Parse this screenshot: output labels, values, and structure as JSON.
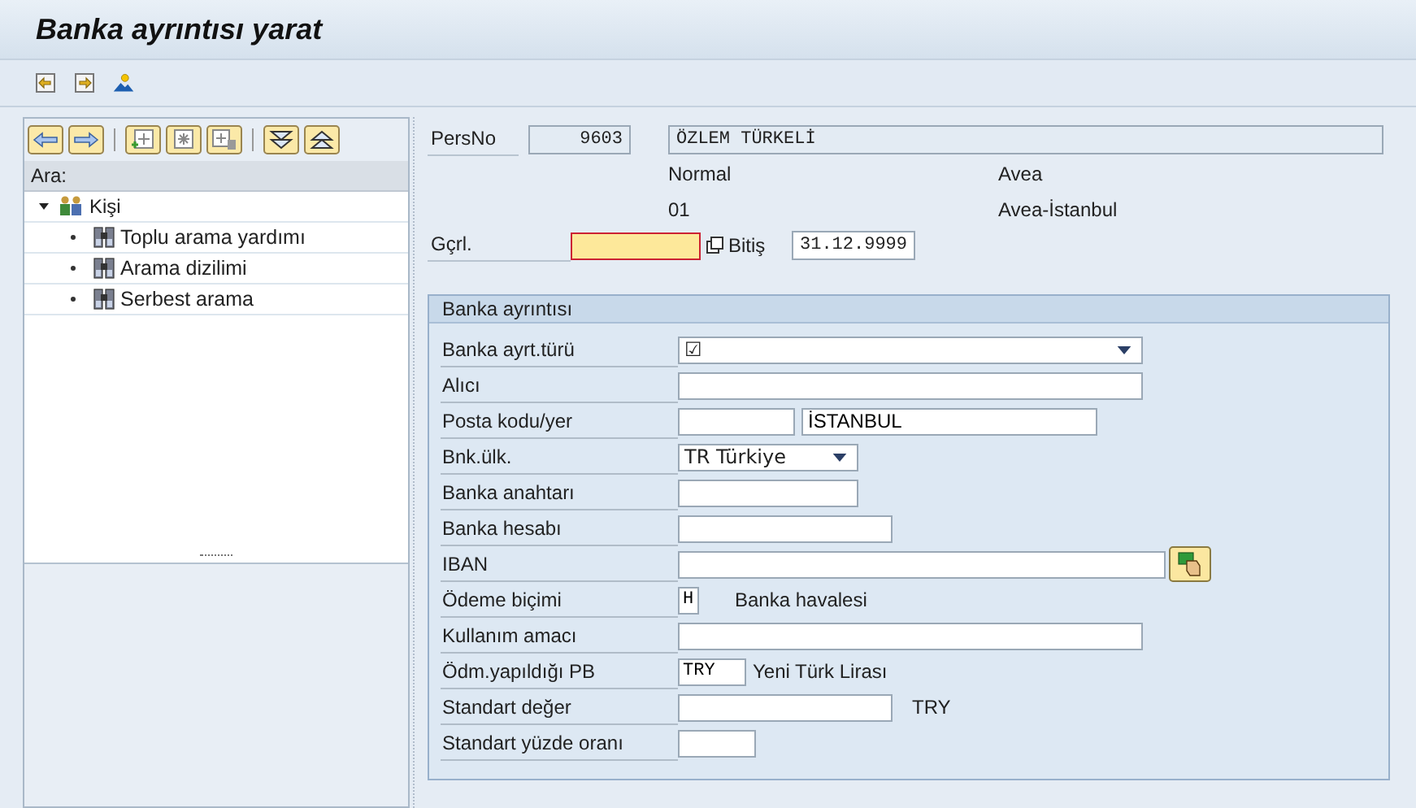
{
  "window": {
    "title": "Banka ayrıntısı yarat"
  },
  "toolbar": [
    {
      "kind": "prev"
    },
    {
      "kind": "next"
    },
    {
      "kind": "image"
    }
  ],
  "left_panel": {
    "toolbar": [
      {
        "kind": "back"
      },
      {
        "kind": "forward"
      },
      {
        "kind": "sep"
      },
      {
        "kind": "new"
      },
      {
        "kind": "star"
      },
      {
        "kind": "delete"
      },
      {
        "kind": "sep"
      },
      {
        "kind": "down"
      },
      {
        "kind": "up"
      }
    ],
    "heading": "Ara:",
    "tree": [
      {
        "label": "Kişi",
        "expanded": true,
        "children": [
          {
            "label": "Toplu arama yardımı"
          },
          {
            "label": "Arama dizilimi"
          },
          {
            "label": "Serbest arama"
          }
        ]
      }
    ]
  },
  "header": {
    "persno_label": "PersNo",
    "persno": "9603",
    "name": "ÖZLEM TÜRKELİ",
    "info": [
      [
        "Normal",
        "Avea"
      ],
      [
        "01",
        "Avea-İstanbul"
      ]
    ],
    "start_label": "Gçrl.",
    "end_label": "Bitiş",
    "end_value": "31.12.9999"
  },
  "bank_section": {
    "title": "Banka ayrıntısı",
    "rows": [
      {
        "label": "Banka ayrt.türü",
        "items": [
          {
            "kind": "dropdown",
            "value": "☑"
          }
        ]
      },
      {
        "label": "Alıcı",
        "items": [
          {
            "kind": "input",
            "value": ""
          }
        ]
      },
      {
        "label": "Posta kodu/yer",
        "items": [
          {
            "kind": "input",
            "value": ""
          },
          {
            "kind": "input",
            "value": "İSTANBUL"
          }
        ]
      },
      {
        "label": "Bnk.ülk.",
        "items": [
          {
            "kind": "dropdown",
            "value": "TR Türkiye"
          }
        ]
      },
      {
        "label": "Banka anahtarı",
        "items": [
          {
            "kind": "input",
            "value": ""
          }
        ]
      },
      {
        "label": "Banka hesabı",
        "items": [
          {
            "kind": "input",
            "value": ""
          }
        ]
      },
      {
        "label": "IBAN",
        "items": [
          {
            "kind": "input",
            "value": ""
          },
          {
            "kind": "button"
          }
        ]
      },
      {
        "label": "Ödeme biçimi",
        "items": [
          {
            "kind": "code",
            "value": "H"
          },
          {
            "kind": "text",
            "value": "Banka havalesi"
          }
        ]
      },
      {
        "label": "Kullanım amacı",
        "items": [
          {
            "kind": "input",
            "value": ""
          }
        ]
      },
      {
        "label": "Ödm.yapıldığı PB",
        "items": [
          {
            "kind": "code",
            "value": "TRY"
          },
          {
            "kind": "text",
            "value": "Yeni Türk Lirası"
          }
        ]
      },
      {
        "label": "Standart değer",
        "items": [
          {
            "kind": "input",
            "value": ""
          },
          {
            "kind": "text",
            "value": "TRY"
          }
        ]
      },
      {
        "label": "Standart yüzde oranı",
        "items": [
          {
            "kind": "input",
            "value": ""
          }
        ]
      }
    ]
  }
}
